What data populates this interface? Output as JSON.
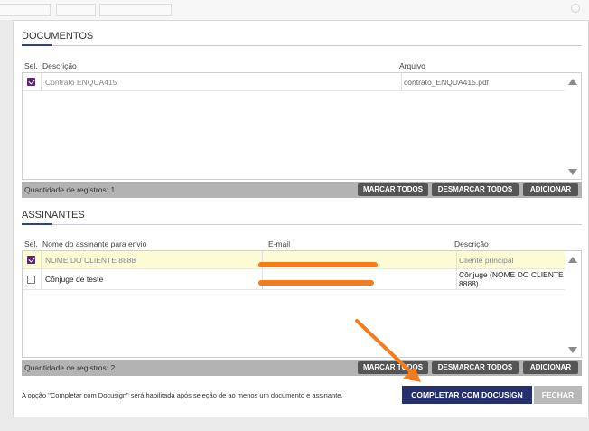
{
  "colors": {
    "accent": "#2c3e8c",
    "primary_button": "#26306e",
    "row_highlight": "#fdfbd5",
    "checkbox": "#5b2770",
    "footer": "#b3b3b3",
    "annotation": "#f47c1c"
  },
  "documentos": {
    "title": "DOCUMENTOS",
    "columns": {
      "sel": "Sel.",
      "descricao": "Descrição",
      "arquivo": "Arquivo"
    },
    "rows": [
      {
        "selected": true,
        "descricao": "Contrato ENQUA415",
        "arquivo": "contrato_ENQUA415.pdf"
      }
    ],
    "count_label": "Quantidade de registros: 1",
    "buttons": {
      "marcar": "MARCAR TODOS",
      "desmarcar": "DESMARCAR TODOS",
      "adicionar": "ADICIONAR"
    }
  },
  "assinantes": {
    "title": "ASSINANTES",
    "columns": {
      "sel": "Sel.",
      "nome": "Nome do assinante para envio",
      "email": "E-mail",
      "descricao": "Descrição"
    },
    "rows": [
      {
        "selected": true,
        "nome": "NOME DO CLIENTE 8888",
        "email": "",
        "descricao": "Cliente principal"
      },
      {
        "selected": false,
        "nome": "Cônjuge de teste",
        "email": "",
        "descricao": "Cônjuge (NOME DO CLIENTE 8888)"
      }
    ],
    "count_label": "Quantidade de registros: 2",
    "buttons": {
      "marcar": "MARCAR TODOS",
      "desmarcar": "DESMARCAR TODOS",
      "adicionar": "ADICIONAR"
    }
  },
  "footer": {
    "note": "A opção \"Completar com Docusign\" será habilitada após seleção de ao menos um documento e assinante.",
    "complete_button": "COMPLETAR COM DOCUSIGN",
    "close_button": "FECHAR"
  }
}
